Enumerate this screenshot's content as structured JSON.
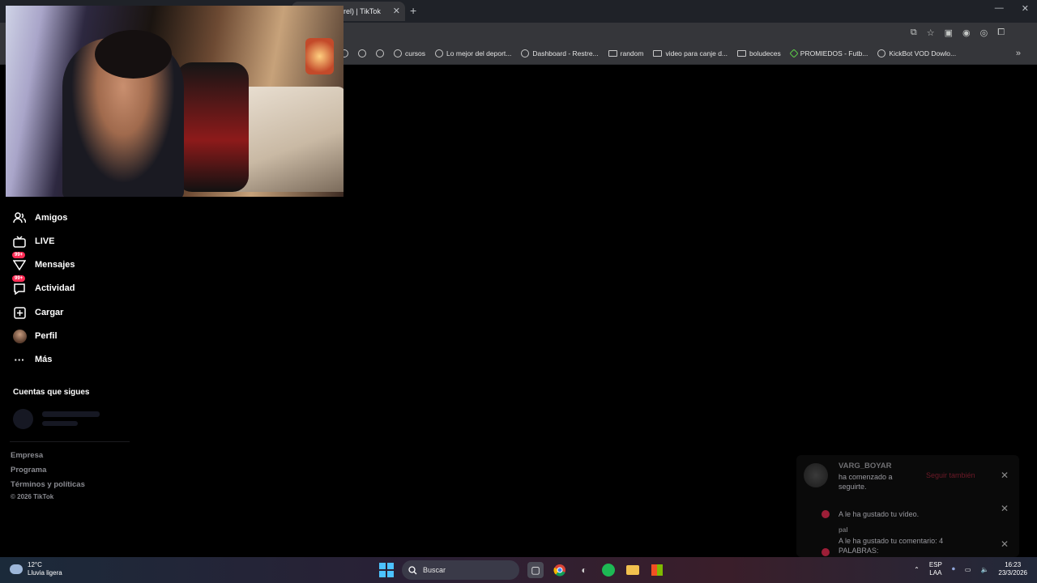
{
  "browser": {
    "tab_title": "rel) | TikTok",
    "tab_close": "✕",
    "new_tab": "+",
    "window_controls": [
      "—",
      "✕"
    ]
  },
  "bookmarks": [
    {
      "label": "cursos",
      "icon": "globe-icon"
    },
    {
      "label": "Lo mejor del deport...",
      "icon": "globe-icon"
    },
    {
      "label": "Dashboard - Restre...",
      "icon": "globe-icon"
    },
    {
      "label": "random",
      "icon": "folder-icon"
    },
    {
      "label": "video para canje d...",
      "icon": "folder-icon"
    },
    {
      "label": "boludeces",
      "icon": "folder-icon"
    },
    {
      "label": "PROMIEDOS - Futb...",
      "icon": "promiedos-icon"
    },
    {
      "label": "KickBot VOD Dowlo...",
      "icon": "globe-icon"
    }
  ],
  "sidebar": {
    "items": [
      {
        "label": "Amigos",
        "icon": "friends-icon"
      },
      {
        "label": "LIVE",
        "icon": "live-icon"
      },
      {
        "label": "Mensajes",
        "icon": "messages-icon",
        "badge": "99+"
      },
      {
        "label": "Actividad",
        "icon": "activity-icon",
        "badge": "99+"
      },
      {
        "label": "Cargar",
        "icon": "upload-icon"
      },
      {
        "label": "Perfil",
        "icon": "avatar"
      },
      {
        "label": "Más",
        "icon": "more-icon"
      }
    ],
    "following_title": "Cuentas que sigues",
    "footer": [
      "Empresa",
      "Programa",
      "Términos y políticas"
    ],
    "copyright": "© 2026 TikTok"
  },
  "notifications": [
    {
      "user": "VARG_BOYAR",
      "text": "ha comenzado a seguirte.",
      "action": "Seguir también"
    },
    {
      "user": "",
      "text": "A le ha gustado tu vídeo."
    },
    {
      "user": "pal",
      "text": "A le ha gustado tu comentario: 4 PALABRAS:"
    }
  ],
  "taskbar": {
    "weather_temp": "12°C",
    "weather_desc": "Lluvia ligera",
    "search_placeholder": "Buscar",
    "lang_top": "ESP",
    "lang_bottom": "LAA",
    "time": "16:23",
    "date": "23/3/2026"
  }
}
